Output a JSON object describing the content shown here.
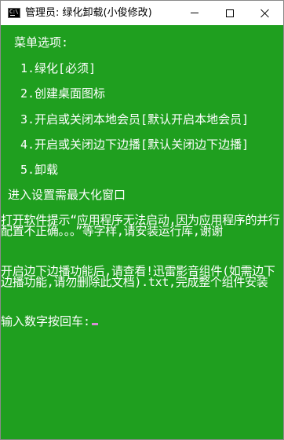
{
  "window": {
    "title": "管理员:  绿化卸载(小俊修改)"
  },
  "console": {
    "menu_header": " 菜单选项:",
    "menu_items": [
      "1.绿化[必须]",
      "2.创建桌面图标",
      "3.开启或关闭本地会员[默认开启本地会员]",
      "4.开启或关闭边下边播[默认关闭边下边播]",
      "5.卸载"
    ],
    "maximize_hint": "进入设置需最大化窗口",
    "runtime_note": " 打开软件提示“应用程序无法启动,因为应用程序的并行配置不正确。。。”等字样,请安装运行库,谢谢",
    "streaming_note": " 开启边下边播功能后,请查看!迅雷影音组件(如需边下边播功能,请勿删除此文档).txt,完成整个组件安装",
    "prompt": "输入数字按回车:"
  },
  "colors": {
    "console_background": "#1f9f1f",
    "console_text": "#ffffff",
    "cursor": "#d48fd4"
  }
}
